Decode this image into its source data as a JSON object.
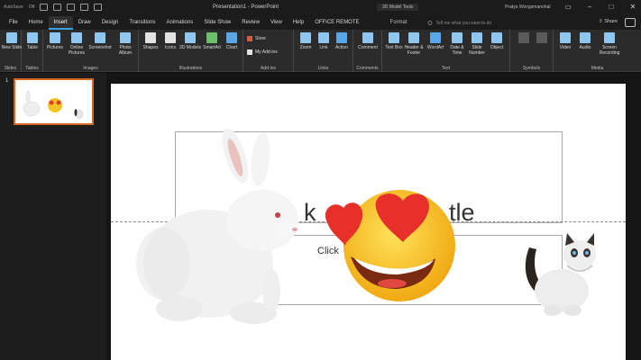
{
  "titlebar": {
    "autosave": "AutoSave",
    "autosave_state": "Off",
    "doc_title": "Presentation1 - PowerPoint",
    "context_tab_group": "3D Model Tools",
    "user": "Pratya Wongsmanohal"
  },
  "tabs": [
    "File",
    "Home",
    "Insert",
    "Draw",
    "Design",
    "Transitions",
    "Animations",
    "Slide Show",
    "Review",
    "View",
    "Help",
    "OFFICE REMOTE"
  ],
  "active_tab": "Insert",
  "format_tab": "Format",
  "tell_me": "Tell me what you want to do",
  "share": "Share",
  "ribbon": {
    "slides": {
      "label": "Slides",
      "commands": [
        "New Slide"
      ]
    },
    "tables": {
      "label": "Tables",
      "commands": [
        "Table"
      ]
    },
    "images": {
      "label": "Images",
      "commands": [
        "Pictures",
        "Online Pictures",
        "Screenshot",
        "Photo Album"
      ]
    },
    "illustrations": {
      "label": "Illustrations",
      "commands": [
        "Shapes",
        "Icons",
        "3D Models",
        "SmartArt",
        "Chart"
      ]
    },
    "addins": {
      "label": "Add-ins",
      "store": "Store",
      "myaddins": "My Add-ins"
    },
    "links": {
      "label": "Links",
      "commands": [
        "Zoom",
        "Link",
        "Action"
      ]
    },
    "comments": {
      "label": "Comments",
      "commands": [
        "Comment"
      ]
    },
    "text": {
      "label": "Text",
      "commands": [
        "Text Box",
        "Header & Footer",
        "WordArt",
        "Date & Time",
        "Slide Number",
        "Object"
      ]
    },
    "symbols": {
      "label": "Symbols"
    },
    "media": {
      "label": "Media",
      "commands": [
        "Video",
        "Audio",
        "Screen Recording"
      ]
    }
  },
  "slide_number": "1",
  "slide": {
    "title_fragment_left": "k",
    "title_fragment_right": "tle",
    "subtitle_fragment": "Click"
  },
  "colors": {
    "accent": "#3aa0e6",
    "thumb_border": "#d2661e"
  }
}
